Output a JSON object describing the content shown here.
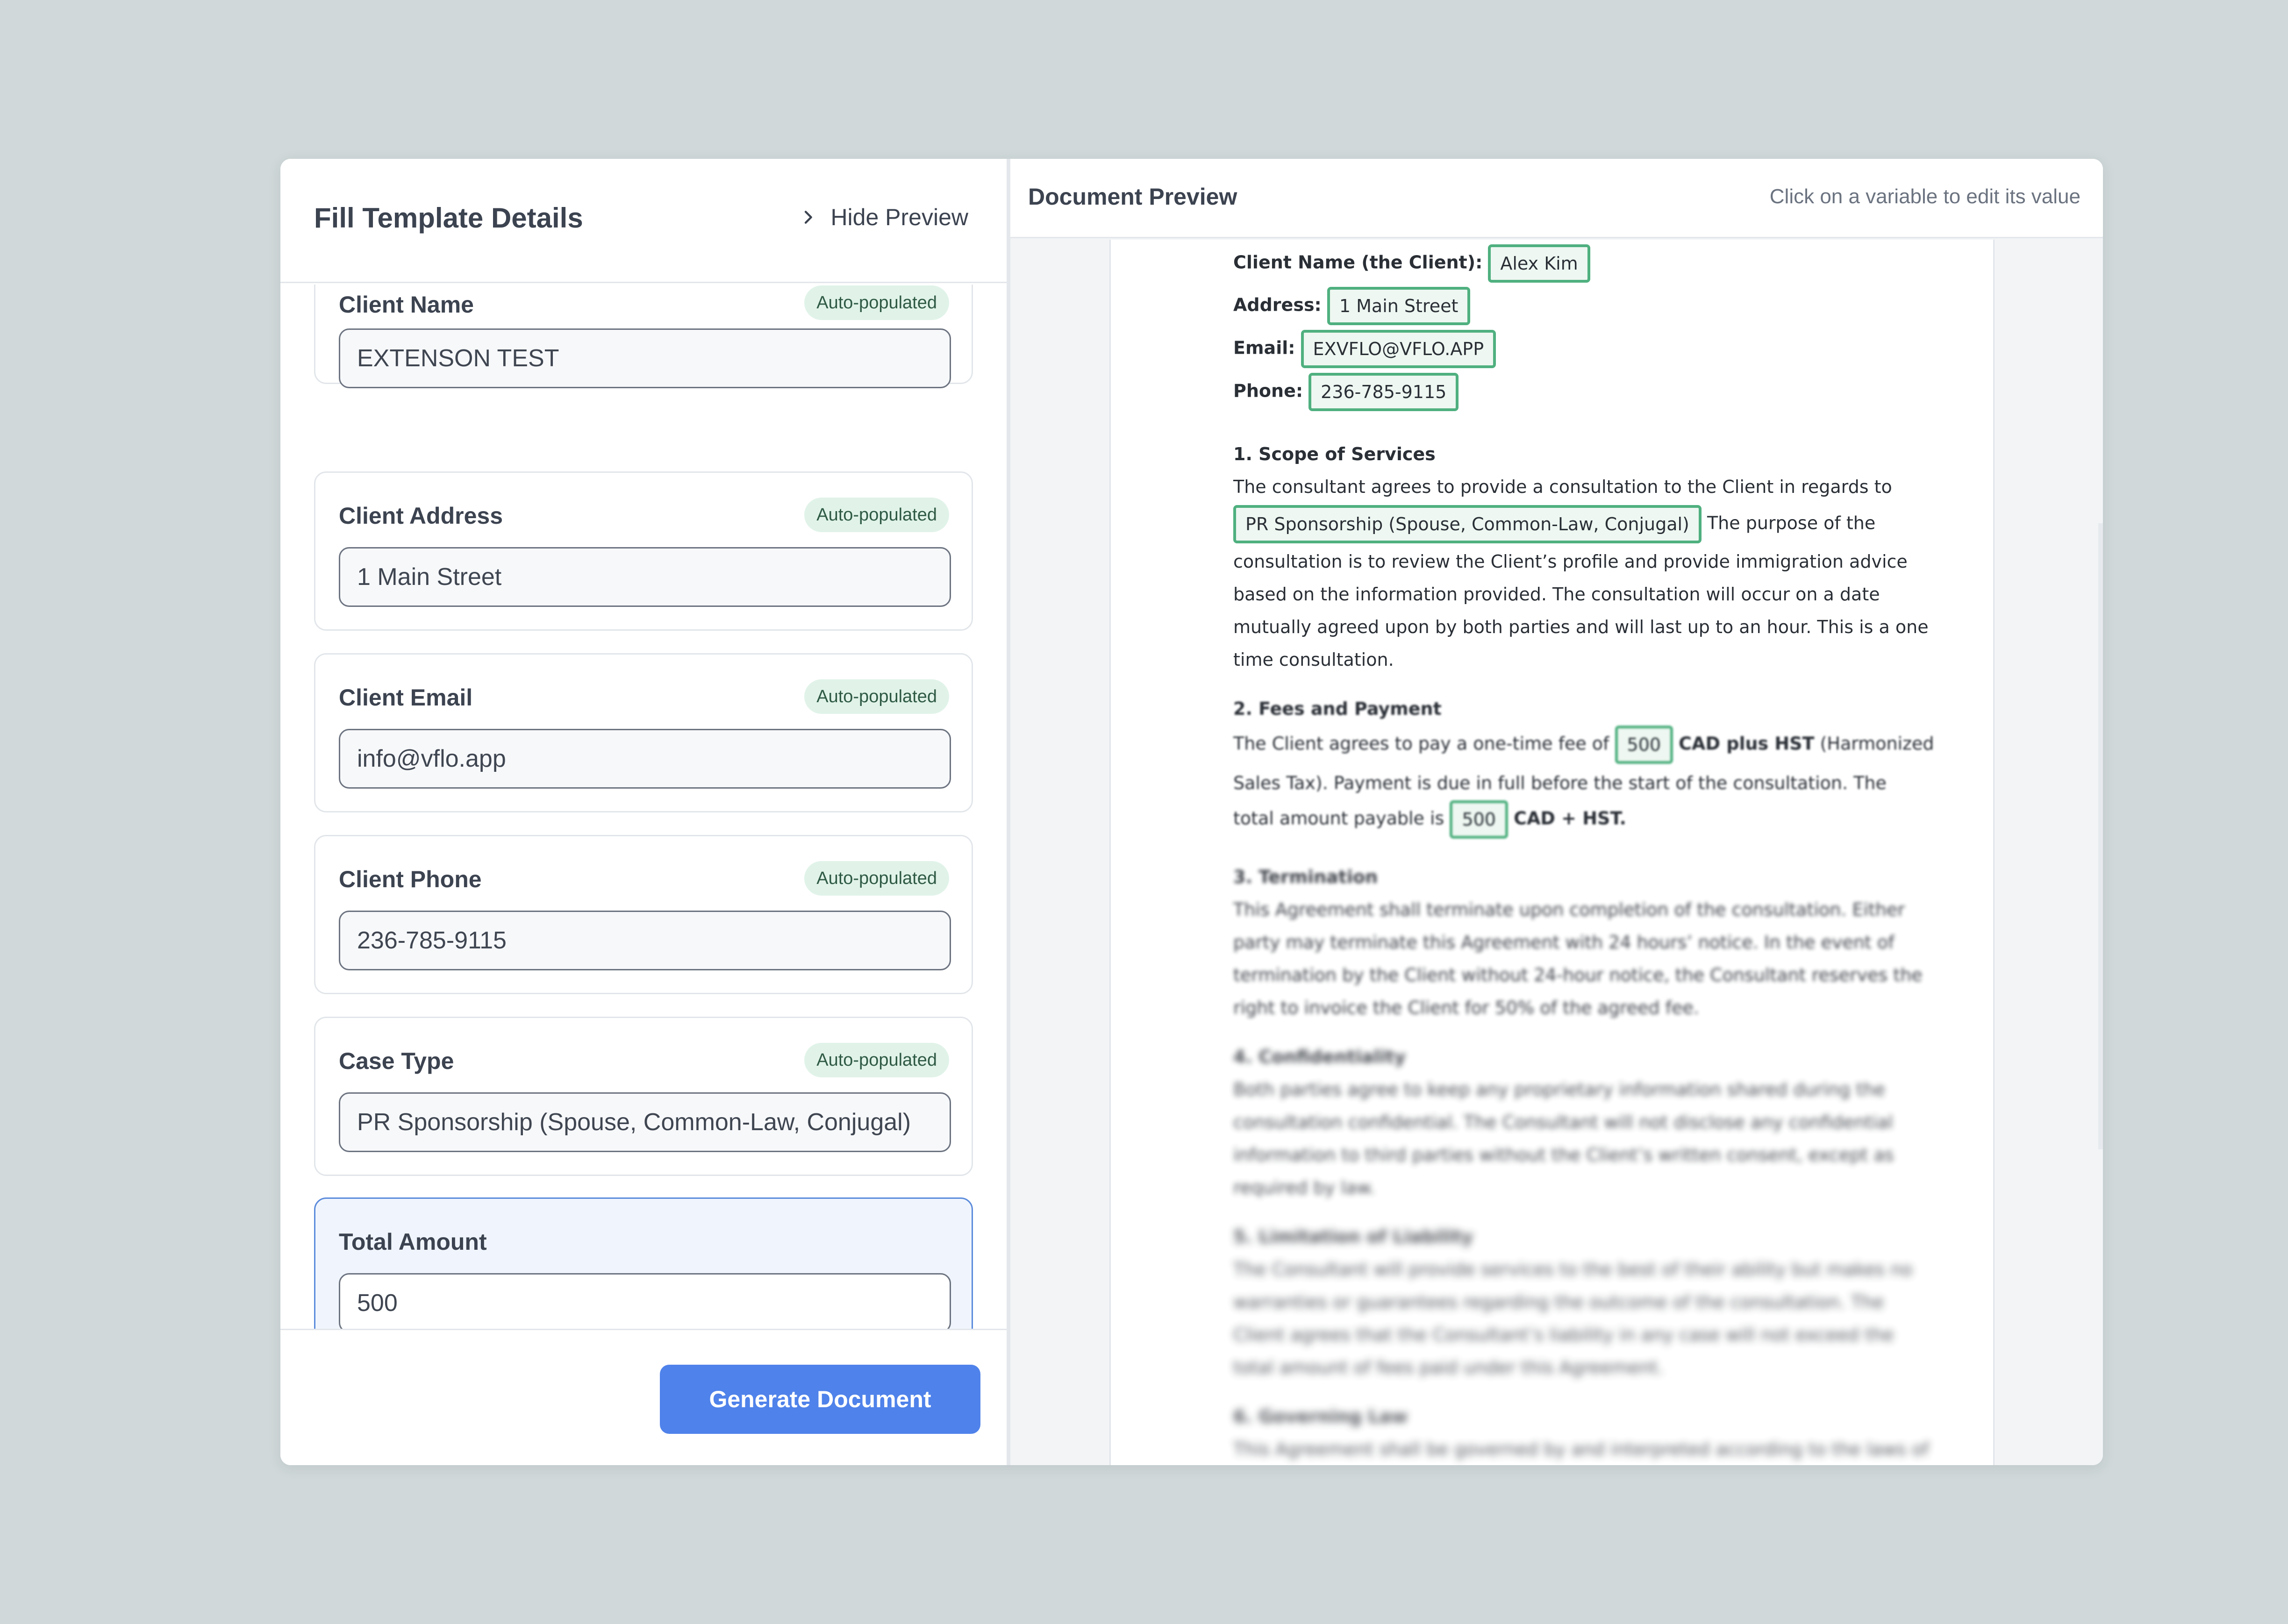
{
  "left": {
    "title": "Fill Template Details",
    "hide_preview_label": "Hide Preview",
    "fields": [
      {
        "label": "Client Name",
        "badge": "Auto-populated",
        "value": "EXTENSON TEST"
      },
      {
        "label": "Client Address",
        "badge": "Auto-populated",
        "value": "1 Main Street"
      },
      {
        "label": "Client Email",
        "badge": "Auto-populated",
        "value": "info@vflo.app"
      },
      {
        "label": "Client Phone",
        "badge": "Auto-populated",
        "value": "236-785-9115"
      },
      {
        "label": "Case Type",
        "badge": "Auto-populated",
        "value": "PR Sponsorship (Spouse, Common-Law, Conjugal)"
      },
      {
        "label": "Total Amount",
        "value": "500"
      }
    ],
    "generate_label": "Generate Document"
  },
  "preview": {
    "title": "Document Preview",
    "hint": "Click on a variable to edit its value",
    "doc": {
      "client_name_label": "Client Name (the Client):",
      "client_name_value": "Alex Kim",
      "address_label": "Address:",
      "address_value": "1 Main Street",
      "email_label": "Email:",
      "email_value": "EXVFLO@VFLO.APP",
      "phone_label": "Phone:",
      "phone_value": "236-785-9115",
      "s1_heading": "1. Scope of Services",
      "s1_line1": "The consultant agrees to provide a consultation to the Client in regards to",
      "s1_case_value": "PR Sponsorship (Spouse, Common-Law, Conjugal)",
      "s1_line2_tail": "The purpose of the",
      "s1_line3": "consultation is to review the Client’s profile and provide immigration advice",
      "s1_line4": "based on the information provided. The consultation will occur on a date",
      "s1_line5": "mutually agreed upon by both parties and will last up to an hour. This is a one",
      "s1_line6": "time consultation.",
      "s2_heading": "2. Fees and Payment",
      "s2_line1_pre": "The Client agrees to pay a one-time fee of",
      "s2_fee_value": "500",
      "s2_line1_bold": "CAD plus HST",
      "s2_line1_post": "(Harmonized",
      "s2_line2": "Sales Tax). Payment is due in full before the start of the consultation. The",
      "s2_line3_pre": "total amount payable is",
      "s2_total_value": "500",
      "s2_line3_bold": "CAD + HST.",
      "s3_heading": "3. Termination",
      "s3_line1": "This Agreement shall terminate upon completion of the consultation. Either",
      "s3_line2": "party may terminate this Agreement with 24 hours’ notice. In the event of",
      "s3_line3": "termination by the Client without 24-hour notice, the Consultant reserves the",
      "s3_line4": "right to invoice the Client for 50% of the agreed fee.",
      "s4_heading": "4. Confidentiality",
      "s4_line1": "Both parties agree to keep any proprietary information shared during the",
      "s4_line2": "consultation confidential. The Consultant will not disclose any confidential",
      "s4_line3": "information to third parties without the Client’s written consent, except as",
      "s4_line4": "required by law.",
      "s5_heading": "5. Limitation of Liability",
      "s5_line1": "The Consultant will provide services to the best of their ability but makes no",
      "s5_line2": "warranties or guarantees regarding the outcome of the consultation. The",
      "s5_line3": "Client agrees that the Consultant’s liability in any case will not exceed the",
      "s5_line4": "total amount of fees paid under this Agreement.",
      "s6_heading": "6. Governing Law",
      "s6_line1": "This Agreement shall be governed by and interpreted according to the laws of"
    }
  },
  "colors": {
    "background": "#d0d8d9",
    "accent_button": "#4f82ea",
    "variable_border": "#4fb07f",
    "badge_bg": "#e1f3e9",
    "active_card_border": "#5b8bdb"
  }
}
